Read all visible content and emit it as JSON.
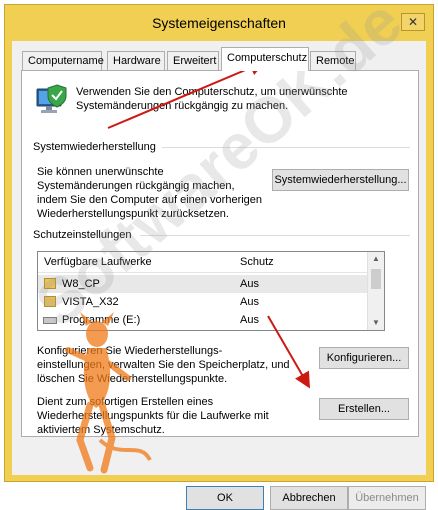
{
  "window": {
    "title": "Systemeigenschaften",
    "close_glyph": "✕"
  },
  "tabs": [
    {
      "label": "Computername",
      "active": false
    },
    {
      "label": "Hardware",
      "active": false
    },
    {
      "label": "Erweitert",
      "active": false
    },
    {
      "label": "Computerschutz",
      "active": true
    },
    {
      "label": "Remote",
      "active": false
    }
  ],
  "intro": {
    "line1": "Verwenden Sie den Computerschutz, um unerwünschte",
    "line2": "Systemänderungen rückgängig zu machen."
  },
  "restore": {
    "group_title": "Systemwiederherstellung",
    "desc_line1": "Sie können unerwünschte",
    "desc_line2": "Systemänderungen rückgängig machen,",
    "desc_line3": "indem Sie den Computer auf einen vorherigen",
    "desc_line4": "Wiederherstellungspunkt zurücksetzen.",
    "button_label": "Systemwiederherstellung..."
  },
  "protection": {
    "group_title": "Schutzeinstellungen",
    "columns": [
      "Verfügbare Laufwerke",
      "Schutz"
    ],
    "drives": [
      {
        "name": "W8_CP",
        "status": "Aus",
        "icon": "folder-icon"
      },
      {
        "name": "VISTA_X32",
        "status": "Aus",
        "icon": "folder-icon"
      },
      {
        "name": "Programme (E:)",
        "status": "Aus",
        "icon": "drive-icon"
      }
    ],
    "configure_line1": "Konfigurieren Sie Wiederherstellungs-",
    "configure_line2": "einstellungen, verwalten Sie den Speicherplatz, und",
    "configure_line3": "löschen Sie Wiederherstellungspunkte.",
    "configure_button": "Konfigurieren...",
    "create_line1": "Dient zum sofortigen Erstellen eines",
    "create_line2": "Wiederherstellungspunkts für die Laufwerke mit",
    "create_line3": "aktiviertem Systemschutz.",
    "create_button": "Erstellen..."
  },
  "footer": {
    "ok": "OK",
    "cancel": "Abbrechen",
    "apply": "Übernehmen"
  },
  "watermark": {
    "text": "SoftwareOK.de"
  },
  "colors": {
    "window_frame": "#f0cf53",
    "annotation_arrow": "#cc1a12",
    "watermark_figure": "#f07a17"
  }
}
